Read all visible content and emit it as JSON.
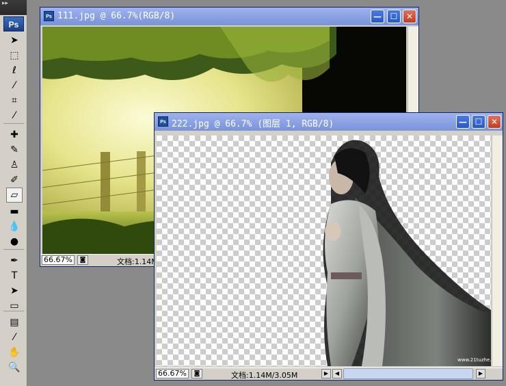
{
  "app": {
    "logo": "Ps"
  },
  "toolbar": {
    "grip": "▸▸",
    "tools": [
      {
        "name": "move-tool",
        "glyph": "➤"
      },
      {
        "name": "marquee-tool",
        "glyph": "⬚"
      },
      {
        "name": "lasso-tool",
        "glyph": "ℓ"
      },
      {
        "name": "magic-wand-tool",
        "glyph": "⁄"
      },
      {
        "name": "crop-tool",
        "glyph": "⌗"
      },
      {
        "name": "eyedropper-tool",
        "glyph": "⁄"
      },
      {
        "name": "healing-brush-tool",
        "glyph": "✚"
      },
      {
        "name": "brush-tool",
        "glyph": "✎"
      },
      {
        "name": "clone-stamp-tool",
        "glyph": "♙"
      },
      {
        "name": "history-brush-tool",
        "glyph": "✐"
      },
      {
        "name": "eraser-tool",
        "glyph": "▱"
      },
      {
        "name": "gradient-tool",
        "glyph": "▬"
      },
      {
        "name": "blur-tool",
        "glyph": "💧"
      },
      {
        "name": "dodge-tool",
        "glyph": "●"
      },
      {
        "name": "pen-tool",
        "glyph": "✒"
      },
      {
        "name": "type-tool",
        "glyph": "T"
      },
      {
        "name": "path-selection-tool",
        "glyph": "➤"
      },
      {
        "name": "shape-tool",
        "glyph": "▭"
      },
      {
        "name": "notes-tool",
        "glyph": "▤"
      },
      {
        "name": "eyedropper-2-tool",
        "glyph": "⁄"
      },
      {
        "name": "hand-tool",
        "glyph": "✋"
      },
      {
        "name": "zoom-tool",
        "glyph": "🔍"
      }
    ]
  },
  "window1": {
    "title": "111.jpg @ 66.7%(RGB/8)",
    "icon": "Ps",
    "minimize": "—",
    "maximize": "☐",
    "close": "✕",
    "zoom": "66.67%",
    "doc_size": "文档:1.14M"
  },
  "window2": {
    "title": "222.jpg @ 66.7% (图层 1, RGB/8)",
    "icon": "Ps",
    "minimize": "—",
    "maximize": "☐",
    "close": "✕",
    "zoom": "66.67%",
    "doc_size": "文档:1.14M/3.05M",
    "arrow_right": "▶",
    "scroll_left": "◀",
    "scroll_right": "▶"
  },
  "colors": {
    "titlebar": "#7993d9",
    "close": "#c23d20",
    "workspace": "#8a8a8a"
  }
}
